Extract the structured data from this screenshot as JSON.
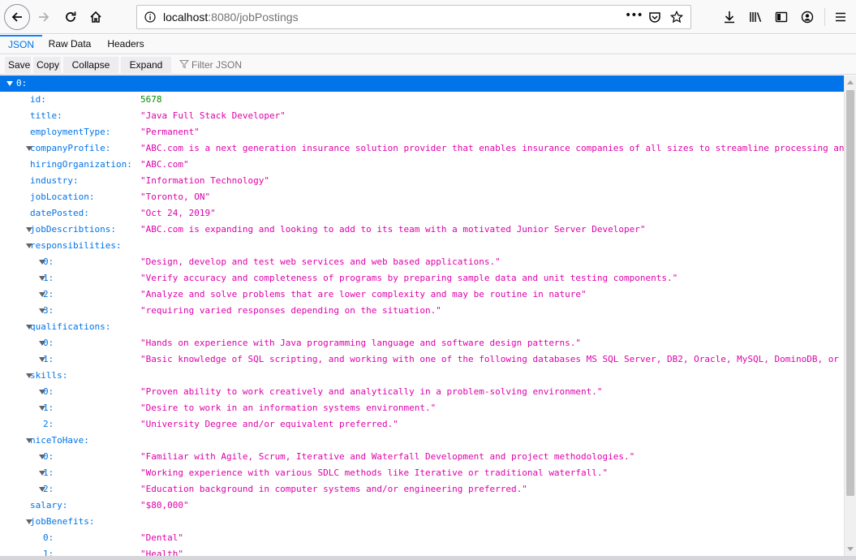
{
  "browser": {
    "url_host": "localhost",
    "url_rest": ":8080/jobPostings",
    "page_actions_label": "•••"
  },
  "viewer": {
    "tabs": [
      {
        "label": "JSON",
        "active": true
      },
      {
        "label": "Raw Data",
        "active": false
      },
      {
        "label": "Headers",
        "active": false
      }
    ],
    "buttons": {
      "save": "Save",
      "copy": "Copy",
      "collapse_all": "Collapse All",
      "expand_all": "Expand All"
    },
    "filter_placeholder": "Filter JSON"
  },
  "colors": {
    "selection": "#0074e8",
    "key": "#0074e8",
    "string": "#dd00a9",
    "number": "#058b00"
  },
  "tree": [
    {
      "depth": 0,
      "key": "0:",
      "value": "",
      "type": "object",
      "toggle": true,
      "selected": true
    },
    {
      "depth": 1,
      "key": "id:",
      "value": "5678",
      "type": "number",
      "toggle": false
    },
    {
      "depth": 1,
      "key": "title:",
      "value": "\"Java Full Stack Developer\"",
      "type": "string",
      "toggle": false
    },
    {
      "depth": 1,
      "key": "employmentType:",
      "value": "\"Permanent\"",
      "type": "string",
      "toggle": false
    },
    {
      "depth": 1,
      "key": "companyProfile:",
      "value": "\"ABC.com is a next generation insurance solution provider that enables insurance companies of all sizes to streamline processing anytime.\"",
      "type": "string",
      "toggle": true
    },
    {
      "depth": 1,
      "key": "hiringOrganization:",
      "value": "\"ABC.com\"",
      "type": "string",
      "toggle": false
    },
    {
      "depth": 1,
      "key": "industry:",
      "value": "\"Information Technology\"",
      "type": "string",
      "toggle": false
    },
    {
      "depth": 1,
      "key": "jobLocation:",
      "value": "\"Toronto, ON\"",
      "type": "string",
      "toggle": false
    },
    {
      "depth": 1,
      "key": "datePosted:",
      "value": "\"Oct 24, 2019\"",
      "type": "string",
      "toggle": false
    },
    {
      "depth": 1,
      "key": "jobDescribtions:",
      "value": "\"ABC.com is expanding and looking to add to its team with a motivated Junior Server Developer\"",
      "type": "string",
      "toggle": true
    },
    {
      "depth": 1,
      "key": "responsibilities:",
      "value": "",
      "type": "array",
      "toggle": true
    },
    {
      "depth": 2,
      "key": "0:",
      "value": "\"Design, develop and test web services and web based applications.\"",
      "type": "string",
      "toggle": true
    },
    {
      "depth": 2,
      "key": "1:",
      "value": "\"Verify accuracy and completeness of programs by preparing sample data and unit testing components.\"",
      "type": "string",
      "toggle": true
    },
    {
      "depth": 2,
      "key": "2:",
      "value": "\"Analyze and solve problems that are lower complexity and may be routine in nature\"",
      "type": "string",
      "toggle": true
    },
    {
      "depth": 2,
      "key": "3:",
      "value": "\"requiring varied responses depending on the situation.\"",
      "type": "string",
      "toggle": true
    },
    {
      "depth": 1,
      "key": "qualifications:",
      "value": "",
      "type": "array",
      "toggle": true
    },
    {
      "depth": 2,
      "key": "0:",
      "value": "\"Hands on experience with Java programming language and software design patterns.\"",
      "type": "string",
      "toggle": true
    },
    {
      "depth": 2,
      "key": "1:",
      "value": "\"Basic knowledge of SQL scripting, and working with one of the following databases MS SQL Server, DB2, Oracle, MySQL, DominoDB, or Postgresql.\"",
      "type": "string",
      "toggle": true
    },
    {
      "depth": 1,
      "key": "skills:",
      "value": "",
      "type": "array",
      "toggle": true
    },
    {
      "depth": 2,
      "key": "0:",
      "value": "\"Proven ability to work creatively and analytically in a problem-solving environment.\"",
      "type": "string",
      "toggle": true
    },
    {
      "depth": 2,
      "key": "1:",
      "value": "\"Desire to work in an information systems environment.\"",
      "type": "string",
      "toggle": true
    },
    {
      "depth": 2,
      "key": "2:",
      "value": "\"University Degree and/or equivalent preferred.\"",
      "type": "string",
      "toggle": false
    },
    {
      "depth": 1,
      "key": "niceToHave:",
      "value": "",
      "type": "array",
      "toggle": true
    },
    {
      "depth": 2,
      "key": "0:",
      "value": "\"Familiar with Agile, Scrum, Iterative and Waterfall Development and project methodologies.\"",
      "type": "string",
      "toggle": true
    },
    {
      "depth": 2,
      "key": "1:",
      "value": "\"Working experience with various SDLC methods like Iterative or traditional waterfall.\"",
      "type": "string",
      "toggle": true
    },
    {
      "depth": 2,
      "key": "2:",
      "value": "\"Education background in computer systems and/or engineering preferred.\"",
      "type": "string",
      "toggle": true
    },
    {
      "depth": 1,
      "key": "salary:",
      "value": "\"$80,000\"",
      "type": "string",
      "toggle": false
    },
    {
      "depth": 1,
      "key": "jobBenefits:",
      "value": "",
      "type": "array",
      "toggle": true
    },
    {
      "depth": 2,
      "key": "0:",
      "value": "\"Dental\"",
      "type": "string",
      "toggle": false
    },
    {
      "depth": 2,
      "key": "1:",
      "value": "\"Health\"",
      "type": "string",
      "toggle": false
    }
  ]
}
